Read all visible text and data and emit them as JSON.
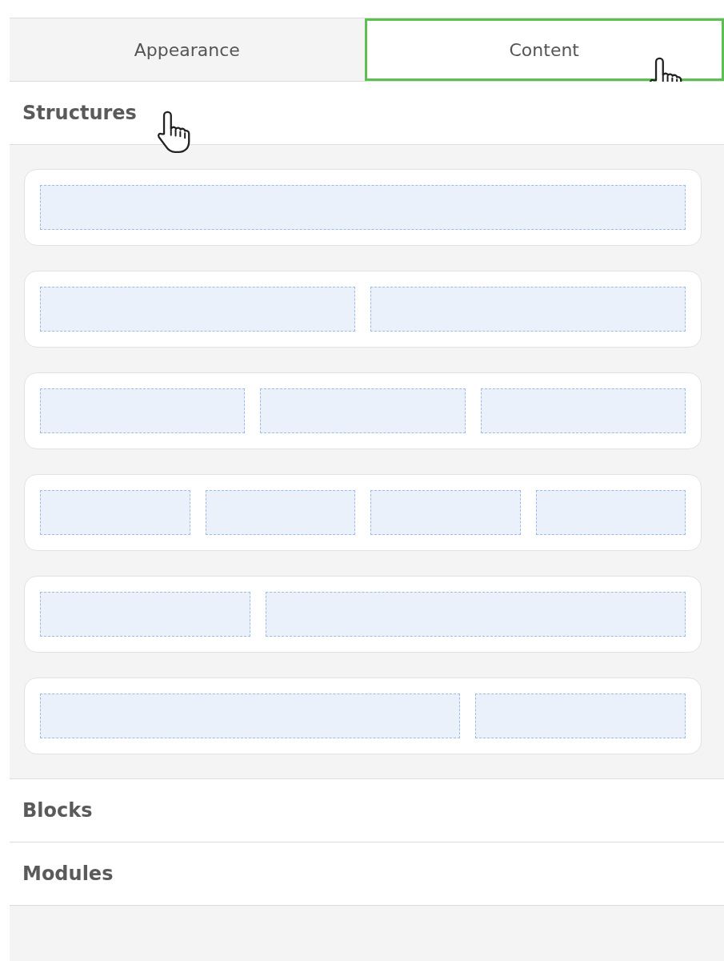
{
  "tabs": [
    {
      "label": "Appearance",
      "selected": false
    },
    {
      "label": "Content",
      "selected": true
    }
  ],
  "sections": [
    {
      "title": "Structures",
      "structures": [
        {
          "kind": "full"
        },
        {
          "kind": "halves"
        },
        {
          "kind": "thirds"
        },
        {
          "kind": "quarters"
        },
        {
          "kind": "third-two-thirds"
        },
        {
          "kind": "two-thirds-third"
        }
      ]
    },
    {
      "title": "Blocks"
    },
    {
      "title": "Modules"
    }
  ]
}
